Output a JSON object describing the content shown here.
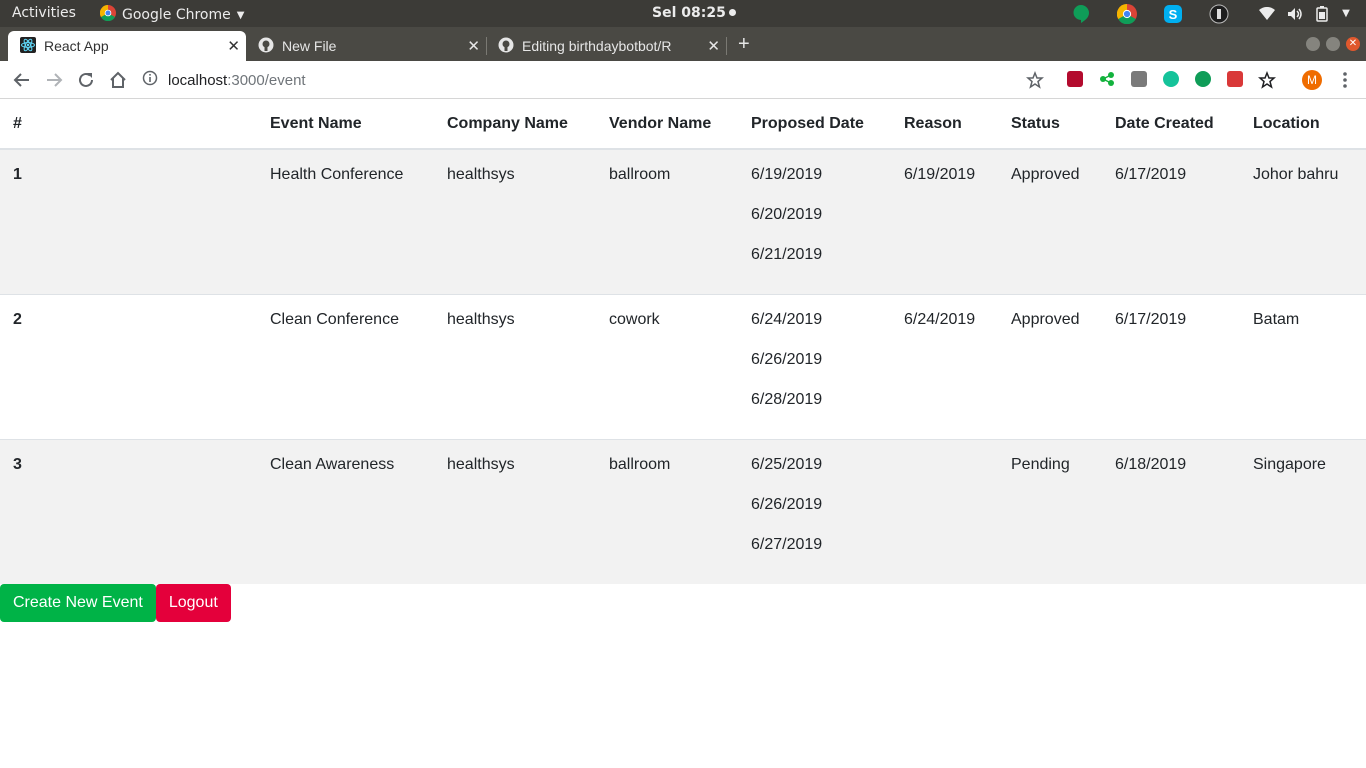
{
  "system": {
    "activities": "Activities",
    "app_name": "Google Chrome",
    "clock": "Sel 08:25"
  },
  "tabs": [
    {
      "title": "React App",
      "active": true
    },
    {
      "title": "New File",
      "active": false
    },
    {
      "title": "Editing birthdaybotbot/R",
      "active": false
    }
  ],
  "address": {
    "host": "localhost",
    "path": ":3000/event"
  },
  "profile_initial": "M",
  "table": {
    "headers": [
      "#",
      "Event Name",
      "Company Name",
      "Vendor Name",
      "Proposed Date",
      "Reason",
      "Status",
      "Date Created",
      "Location"
    ],
    "rows": [
      {
        "id": "1",
        "event_name": "Health Conference",
        "company": "healthsys",
        "vendor": "ballroom",
        "proposed_dates": [
          "6/19/2019",
          "6/20/2019",
          "6/21/2019"
        ],
        "reason": "6/19/2019",
        "status": "Approved",
        "date_created": "6/17/2019",
        "location": "Johor bahru"
      },
      {
        "id": "2",
        "event_name": "Clean Conference",
        "company": "healthsys",
        "vendor": "cowork",
        "proposed_dates": [
          "6/24/2019",
          "6/26/2019",
          "6/28/2019"
        ],
        "reason": "6/24/2019",
        "status": "Approved",
        "date_created": "6/17/2019",
        "location": "Batam"
      },
      {
        "id": "3",
        "event_name": "Clean Awareness",
        "company": "healthsys",
        "vendor": "ballroom",
        "proposed_dates": [
          "6/25/2019",
          "6/26/2019",
          "6/27/2019"
        ],
        "reason": "",
        "status": "Pending",
        "date_created": "6/18/2019",
        "location": "Singapore"
      }
    ]
  },
  "actions": {
    "create_label": "Create New Event",
    "logout_label": "Logout"
  },
  "colors": {
    "create_button": "#00b347",
    "logout_button": "#e4003b"
  }
}
